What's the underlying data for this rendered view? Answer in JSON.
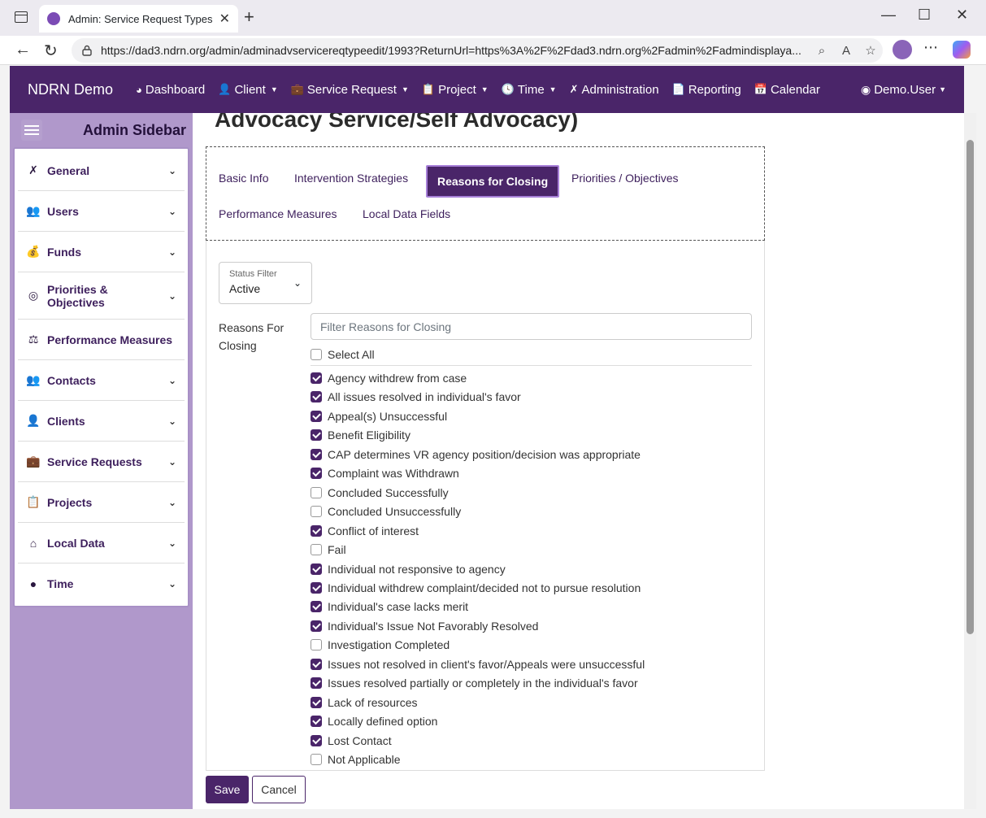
{
  "browser": {
    "tab_title": "Admin: Service Request Types",
    "url": "https://dad3.ndrn.org/admin/adminadvservicereqtypeedit/1993?ReturnUrl=https%3A%2F%2Fdad3.ndrn.org%2Fadmin%2Fadmindisplaya..."
  },
  "navbar": {
    "brand": "NDRN Demo",
    "items": [
      {
        "label": "Dashboard",
        "icon": "dashboard-icon",
        "caret": false
      },
      {
        "label": "Client",
        "icon": "user-icon",
        "caret": true
      },
      {
        "label": "Service Request",
        "icon": "briefcase-icon",
        "caret": true
      },
      {
        "label": "Project",
        "icon": "clipboard-icon",
        "caret": true
      },
      {
        "label": "Time",
        "icon": "clock-icon",
        "caret": true
      },
      {
        "label": "Administration",
        "icon": "tools-icon",
        "caret": false
      },
      {
        "label": "Reporting",
        "icon": "file-icon",
        "caret": false
      },
      {
        "label": "Calendar",
        "icon": "calendar-icon",
        "caret": false
      }
    ],
    "user": "Demo.User"
  },
  "sidebar": {
    "title": "Admin Sidebar",
    "items": [
      {
        "label": "General",
        "icon": "tools-icon",
        "glyph": "✗"
      },
      {
        "label": "Users",
        "icon": "users-icon",
        "glyph": "👥"
      },
      {
        "label": "Funds",
        "icon": "money-bag-icon",
        "glyph": "💰"
      },
      {
        "label": "Priorities & Objectives",
        "icon": "target-icon",
        "glyph": "◎"
      },
      {
        "label": "Performance Measures",
        "icon": "scale-icon",
        "glyph": "⚖"
      },
      {
        "label": "Contacts",
        "icon": "users-icon",
        "glyph": "👥"
      },
      {
        "label": "Clients",
        "icon": "user-icon",
        "glyph": "👤"
      },
      {
        "label": "Service Requests",
        "icon": "briefcase-icon",
        "glyph": "💼"
      },
      {
        "label": "Projects",
        "icon": "clipboard-icon",
        "glyph": "📋"
      },
      {
        "label": "Local Data",
        "icon": "house-icon",
        "glyph": "⌂"
      },
      {
        "label": "Time",
        "icon": "clock-icon",
        "glyph": "●"
      }
    ]
  },
  "page": {
    "title": "Advocacy Service/Self Advocacy)"
  },
  "tabs": {
    "basic_info": "Basic Info",
    "intervention": "Intervention Strategies",
    "reasons": "Reasons for Closing",
    "priorities": "Priorities / Objectives",
    "performance": "Performance Measures",
    "local_data": "Local Data Fields",
    "active": "Reasons for Closing"
  },
  "status_filter": {
    "label": "Status Filter",
    "value": "Active"
  },
  "reasons": {
    "label": "Reasons For Closing",
    "filter_placeholder": "Filter Reasons for Closing",
    "select_all": "Select All",
    "items": [
      {
        "label": "Agency withdrew from case",
        "checked": true
      },
      {
        "label": "All issues resolved in individual's favor",
        "checked": true
      },
      {
        "label": "Appeal(s) Unsuccessful",
        "checked": true
      },
      {
        "label": "Benefit Eligibility",
        "checked": true
      },
      {
        "label": "CAP determines VR agency position/decision was appropriate",
        "checked": true
      },
      {
        "label": "Complaint was Withdrawn",
        "checked": true
      },
      {
        "label": "Concluded Successfully",
        "checked": false
      },
      {
        "label": "Concluded Unsuccessfully",
        "checked": false
      },
      {
        "label": "Conflict of interest",
        "checked": true
      },
      {
        "label": "Fail",
        "checked": false
      },
      {
        "label": "Individual not responsive to agency",
        "checked": true
      },
      {
        "label": "Individual withdrew complaint/decided not to pursue resolution",
        "checked": true
      },
      {
        "label": "Individual's case lacks merit",
        "checked": true
      },
      {
        "label": "Individual's Issue Not Favorably Resolved",
        "checked": true
      },
      {
        "label": "Investigation Completed",
        "checked": false
      },
      {
        "label": "Issues not resolved in client's favor/Appeals were unsuccessful",
        "checked": true
      },
      {
        "label": "Issues resolved partially or completely in the individual's favor",
        "checked": true
      },
      {
        "label": "Lack of resources",
        "checked": true
      },
      {
        "label": "Locally defined option",
        "checked": true
      },
      {
        "label": "Lost Contact",
        "checked": true
      },
      {
        "label": "Not Applicable",
        "checked": false
      }
    ]
  },
  "actions": {
    "save": "Save",
    "cancel": "Cancel"
  },
  "colors": {
    "primary": "#4a2569",
    "sidebar_bg": "#b098cb"
  }
}
